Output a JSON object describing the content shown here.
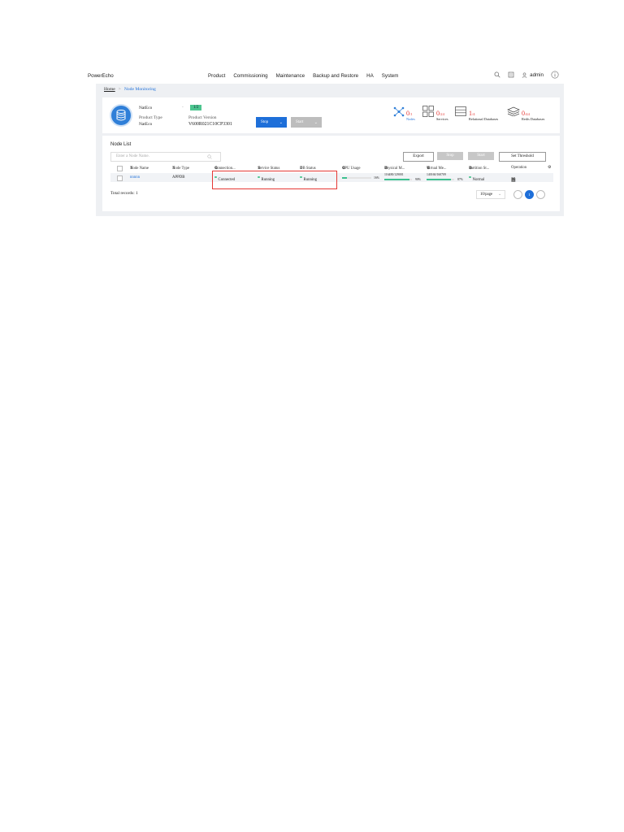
{
  "app": {
    "brand": "PowerEcho"
  },
  "nav": {
    "items": [
      "Product",
      "Commissioning",
      "Maintenance",
      "Backup and Restore",
      "HA",
      "System"
    ],
    "user": "admin"
  },
  "breadcrumb": {
    "home": "Home",
    "separator": ">",
    "current": "Node Monitoring"
  },
  "summary": {
    "product_name": "NatEco",
    "dash": "-",
    "version_badge": "1/2",
    "product_type_label": "Product Type",
    "product_type_value": "NatEco",
    "product_version_label": "Product Version",
    "product_version_value": "V600R021C10CP3301",
    "stop_label": "Stop",
    "start_label": "Start",
    "stats": [
      {
        "num": "0",
        "den": "/1",
        "label": "Nodes"
      },
      {
        "num": "0",
        "den": "/24",
        "label": "Services"
      },
      {
        "num": "1",
        "den": "/4",
        "label": "Relational Databases"
      },
      {
        "num": "0",
        "den": "/44",
        "label": "Redis Databases"
      }
    ]
  },
  "node_list": {
    "title": "Node List",
    "search_placeholder": "Enter a Node Name.",
    "toolbar": {
      "export": "Export",
      "stop": "Stop",
      "start": "Start",
      "set_threshold": "Set Threshold"
    },
    "columns": [
      "Node Name",
      "Node Type",
      "Connection...",
      "Service Status",
      "DB Status",
      "CPU Usage",
      "Physical M...",
      "Virtual Me...",
      "Partition St...",
      "Operation"
    ],
    "rows": [
      {
        "node_name": "nnnnn",
        "node_type": "APPDB",
        "connection": "Connected",
        "service_status": "Running",
        "db_status": "Running",
        "cpu_pct": "16%",
        "cpu_fill": 0.16,
        "phys_mem": "116480/129001",
        "phys_pct": "90%",
        "phys_fill": 0.9,
        "virt_mem": "140160/160709",
        "virt_pct": "87%",
        "virt_fill": 0.87,
        "partition": "Normal"
      }
    ],
    "total": "Total records: 1",
    "pager": {
      "page_size": "10/page",
      "current_page": "1"
    }
  },
  "colors": {
    "accent": "#1e6fd9",
    "ok": "#4cc58f",
    "alert": "#e53935"
  }
}
